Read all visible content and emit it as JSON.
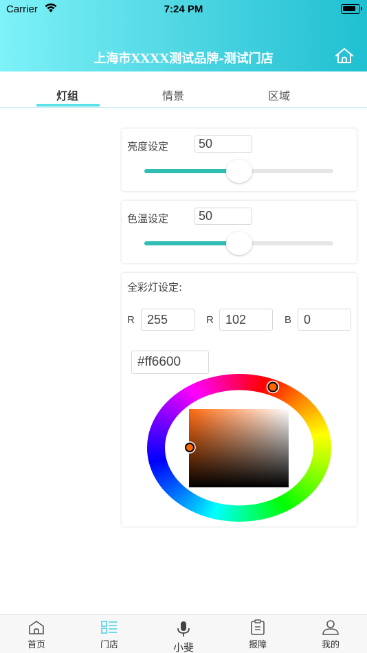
{
  "status_bar": {
    "carrier": "Carrier",
    "time": "7:24 PM"
  },
  "header": {
    "title": "上海市XXXX测试品牌-测试门店",
    "home_icon": "home-icon"
  },
  "tabs": [
    {
      "label": "灯组",
      "active": true
    },
    {
      "label": "情景",
      "active": false
    },
    {
      "label": "区域",
      "active": false
    }
  ],
  "brightness": {
    "label": "亮度设定",
    "value": "50",
    "slider_percent": 50
  },
  "color_temp": {
    "label": "色温设定",
    "value": "50",
    "slider_percent": 50
  },
  "full_color": {
    "label": "全彩灯设定:",
    "r_label": "R",
    "r_value": "255",
    "g_label": "R",
    "g_value": "102",
    "b_label": "B",
    "b_value": "0",
    "hex": "#ff6600"
  },
  "bottom_nav": [
    {
      "label": "首页",
      "icon": "home-icon",
      "active": false
    },
    {
      "label": "门店",
      "icon": "store-list-icon",
      "active": true
    },
    {
      "label": "小斐",
      "icon": "microphone-icon",
      "active": false
    },
    {
      "label": "报障",
      "icon": "report-icon",
      "active": false
    },
    {
      "label": "我的",
      "icon": "user-icon",
      "active": false
    }
  ],
  "colors": {
    "header_gradient_start": "#7ef2f8",
    "header_gradient_end": "#1fc0d1",
    "accent": "#5ce1ea",
    "slider_fill": "#30bdb2",
    "active_nav_icon": "#4fd2e6"
  }
}
